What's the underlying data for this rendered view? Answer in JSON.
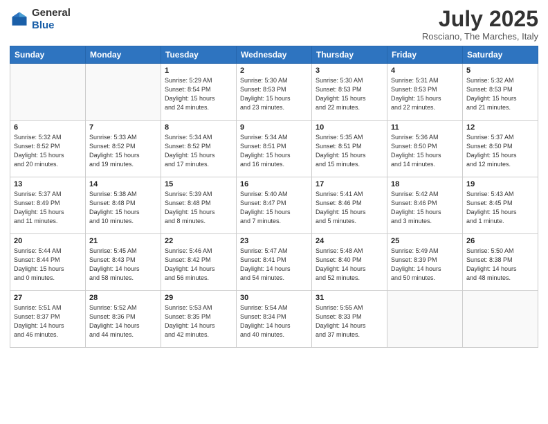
{
  "header": {
    "logo_line1": "General",
    "logo_line2": "Blue",
    "month": "July 2025",
    "location": "Rosciano, The Marches, Italy"
  },
  "days_of_week": [
    "Sunday",
    "Monday",
    "Tuesday",
    "Wednesday",
    "Thursday",
    "Friday",
    "Saturday"
  ],
  "weeks": [
    [
      {
        "day": "",
        "info": ""
      },
      {
        "day": "",
        "info": ""
      },
      {
        "day": "1",
        "info": "Sunrise: 5:29 AM\nSunset: 8:54 PM\nDaylight: 15 hours\nand 24 minutes."
      },
      {
        "day": "2",
        "info": "Sunrise: 5:30 AM\nSunset: 8:53 PM\nDaylight: 15 hours\nand 23 minutes."
      },
      {
        "day": "3",
        "info": "Sunrise: 5:30 AM\nSunset: 8:53 PM\nDaylight: 15 hours\nand 22 minutes."
      },
      {
        "day": "4",
        "info": "Sunrise: 5:31 AM\nSunset: 8:53 PM\nDaylight: 15 hours\nand 22 minutes."
      },
      {
        "day": "5",
        "info": "Sunrise: 5:32 AM\nSunset: 8:53 PM\nDaylight: 15 hours\nand 21 minutes."
      }
    ],
    [
      {
        "day": "6",
        "info": "Sunrise: 5:32 AM\nSunset: 8:52 PM\nDaylight: 15 hours\nand 20 minutes."
      },
      {
        "day": "7",
        "info": "Sunrise: 5:33 AM\nSunset: 8:52 PM\nDaylight: 15 hours\nand 19 minutes."
      },
      {
        "day": "8",
        "info": "Sunrise: 5:34 AM\nSunset: 8:52 PM\nDaylight: 15 hours\nand 17 minutes."
      },
      {
        "day": "9",
        "info": "Sunrise: 5:34 AM\nSunset: 8:51 PM\nDaylight: 15 hours\nand 16 minutes."
      },
      {
        "day": "10",
        "info": "Sunrise: 5:35 AM\nSunset: 8:51 PM\nDaylight: 15 hours\nand 15 minutes."
      },
      {
        "day": "11",
        "info": "Sunrise: 5:36 AM\nSunset: 8:50 PM\nDaylight: 15 hours\nand 14 minutes."
      },
      {
        "day": "12",
        "info": "Sunrise: 5:37 AM\nSunset: 8:50 PM\nDaylight: 15 hours\nand 12 minutes."
      }
    ],
    [
      {
        "day": "13",
        "info": "Sunrise: 5:37 AM\nSunset: 8:49 PM\nDaylight: 15 hours\nand 11 minutes."
      },
      {
        "day": "14",
        "info": "Sunrise: 5:38 AM\nSunset: 8:48 PM\nDaylight: 15 hours\nand 10 minutes."
      },
      {
        "day": "15",
        "info": "Sunrise: 5:39 AM\nSunset: 8:48 PM\nDaylight: 15 hours\nand 8 minutes."
      },
      {
        "day": "16",
        "info": "Sunrise: 5:40 AM\nSunset: 8:47 PM\nDaylight: 15 hours\nand 7 minutes."
      },
      {
        "day": "17",
        "info": "Sunrise: 5:41 AM\nSunset: 8:46 PM\nDaylight: 15 hours\nand 5 minutes."
      },
      {
        "day": "18",
        "info": "Sunrise: 5:42 AM\nSunset: 8:46 PM\nDaylight: 15 hours\nand 3 minutes."
      },
      {
        "day": "19",
        "info": "Sunrise: 5:43 AM\nSunset: 8:45 PM\nDaylight: 15 hours\nand 1 minute."
      }
    ],
    [
      {
        "day": "20",
        "info": "Sunrise: 5:44 AM\nSunset: 8:44 PM\nDaylight: 15 hours\nand 0 minutes."
      },
      {
        "day": "21",
        "info": "Sunrise: 5:45 AM\nSunset: 8:43 PM\nDaylight: 14 hours\nand 58 minutes."
      },
      {
        "day": "22",
        "info": "Sunrise: 5:46 AM\nSunset: 8:42 PM\nDaylight: 14 hours\nand 56 minutes."
      },
      {
        "day": "23",
        "info": "Sunrise: 5:47 AM\nSunset: 8:41 PM\nDaylight: 14 hours\nand 54 minutes."
      },
      {
        "day": "24",
        "info": "Sunrise: 5:48 AM\nSunset: 8:40 PM\nDaylight: 14 hours\nand 52 minutes."
      },
      {
        "day": "25",
        "info": "Sunrise: 5:49 AM\nSunset: 8:39 PM\nDaylight: 14 hours\nand 50 minutes."
      },
      {
        "day": "26",
        "info": "Sunrise: 5:50 AM\nSunset: 8:38 PM\nDaylight: 14 hours\nand 48 minutes."
      }
    ],
    [
      {
        "day": "27",
        "info": "Sunrise: 5:51 AM\nSunset: 8:37 PM\nDaylight: 14 hours\nand 46 minutes."
      },
      {
        "day": "28",
        "info": "Sunrise: 5:52 AM\nSunset: 8:36 PM\nDaylight: 14 hours\nand 44 minutes."
      },
      {
        "day": "29",
        "info": "Sunrise: 5:53 AM\nSunset: 8:35 PM\nDaylight: 14 hours\nand 42 minutes."
      },
      {
        "day": "30",
        "info": "Sunrise: 5:54 AM\nSunset: 8:34 PM\nDaylight: 14 hours\nand 40 minutes."
      },
      {
        "day": "31",
        "info": "Sunrise: 5:55 AM\nSunset: 8:33 PM\nDaylight: 14 hours\nand 37 minutes."
      },
      {
        "day": "",
        "info": ""
      },
      {
        "day": "",
        "info": ""
      }
    ]
  ]
}
